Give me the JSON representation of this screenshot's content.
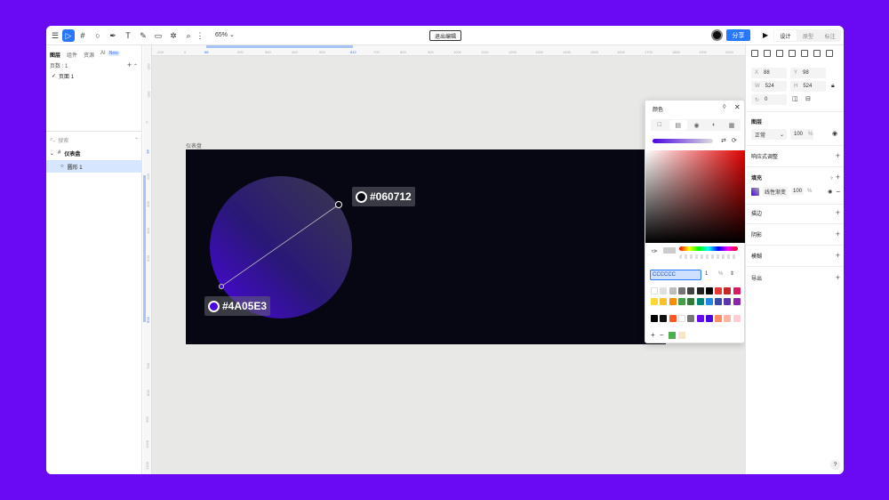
{
  "toolbar": {
    "zoom": "65%",
    "exit_edit_label": "退出编辑",
    "share_label": "分享",
    "modes": [
      "设计",
      "原型",
      "标注"
    ]
  },
  "left_panel": {
    "tabs": [
      "图层",
      "组件",
      "资源",
      "AI"
    ],
    "new_badge": "New",
    "pages_label": "页数 : 1",
    "page_item": "页面 1",
    "search_placeholder": "搜索",
    "layers": [
      {
        "label": "仪表盘"
      },
      {
        "label": "圆形 1"
      }
    ]
  },
  "canvas": {
    "frame_label": "仪表盘",
    "ruler_top": [
      "-100",
      "0",
      "88",
      "200",
      "300",
      "400",
      "500",
      "612",
      "700",
      "800",
      "900",
      "1000",
      "1100",
      "1200",
      "1300",
      "1400",
      "1500",
      "1600",
      "1700",
      "1800",
      "1900",
      "2000"
    ],
    "ruler_left": [
      "-200",
      "-100",
      "0",
      "98",
      "200",
      "300",
      "400",
      "500",
      "622",
      "700",
      "800",
      "900",
      "1000",
      "1100",
      "1200"
    ],
    "stop_end": "#060712",
    "stop_start": "#4A05E3"
  },
  "color_picker": {
    "title": "颜色",
    "hex_value": "CCCCCC",
    "alpha_value": "1",
    "alpha_unit": "%",
    "swatches_row1": [
      "#ffffff",
      "#e0e0e0",
      "#bdbdbd",
      "#757575",
      "#424242",
      "#212121",
      "#000000",
      "#e53935",
      "#c62828",
      "#d81b60"
    ],
    "swatches_row2": [
      "#fdd835",
      "#fbc02d",
      "#fb8c00",
      "#43a047",
      "#2e7d32",
      "#00897b",
      "#1e88e5",
      "#3949ab",
      "#5e35b1",
      "#8e24aa"
    ],
    "swatches_row3": [
      "#000000",
      "#111111",
      "#ff5722",
      "#ffffff",
      "#777777",
      "#6a0af5",
      "#4a05e3",
      "#ff8a65",
      "#ffb4a2",
      "#ffcdd2"
    ],
    "recent": [
      "#4caf50",
      "#f5e6c8"
    ]
  },
  "right_panel": {
    "x_label": "X",
    "x_value": "88",
    "y_label": "Y",
    "y_value": "98",
    "w_label": "W",
    "w_value": "524",
    "h_label": "H",
    "h_value": "524",
    "rotation": "0",
    "layer_section": "图层",
    "blend_mode": "正常",
    "opacity": "100",
    "opacity_unit": "%",
    "responsive": "响应式调整",
    "fill_section": "填充",
    "fill_type": "线性渐变",
    "fill_opacity": "100",
    "stroke": "描边",
    "shadow": "阴影",
    "blur": "模糊",
    "export": "导出",
    "help": "?"
  }
}
